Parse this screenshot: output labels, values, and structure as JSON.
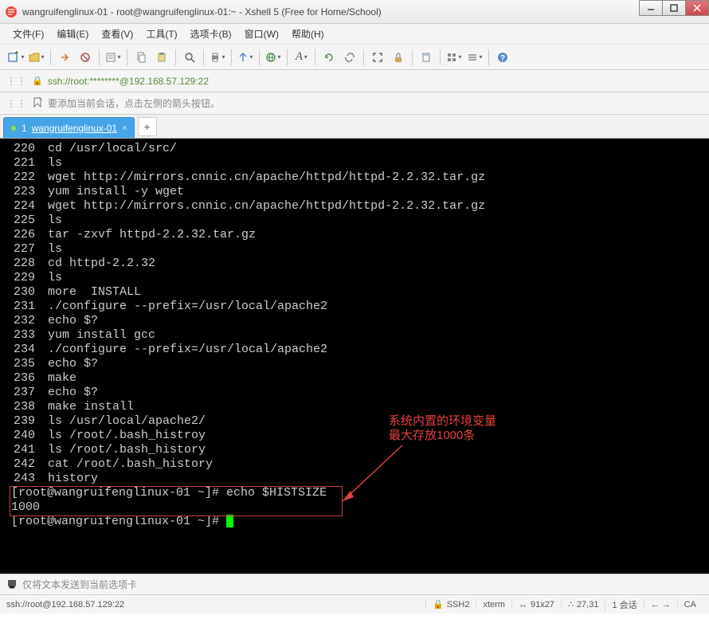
{
  "window": {
    "title": "wangruifenglinux-01 - root@wangruifenglinux-01:~ - Xshell 5 (Free for Home/School)"
  },
  "menu": {
    "file": "文件(F)",
    "edit": "编辑(E)",
    "view": "查看(V)",
    "tools": "工具(T)",
    "tabs": "选项卡(B)",
    "window": "窗口(W)",
    "help": "帮助(H)"
  },
  "address": {
    "url": "ssh://root:********@192.168.57.129:22"
  },
  "infobar": {
    "text": "要添加当前会话，点击左侧的箭头按钮。"
  },
  "tab": {
    "index": "1",
    "label": "wangruifenglinux-01"
  },
  "terminal": {
    "lines": [
      {
        "n": "220",
        "t": "cd /usr/local/src/"
      },
      {
        "n": "221",
        "t": "ls"
      },
      {
        "n": "222",
        "t": "wget http://mirrors.cnnic.cn/apache/httpd/httpd-2.2.32.tar.gz"
      },
      {
        "n": "223",
        "t": "yum install -y wget"
      },
      {
        "n": "224",
        "t": "wget http://mirrors.cnnic.cn/apache/httpd/httpd-2.2.32.tar.gz"
      },
      {
        "n": "225",
        "t": "ls"
      },
      {
        "n": "226",
        "t": "tar -zxvf httpd-2.2.32.tar.gz"
      },
      {
        "n": "227",
        "t": "ls"
      },
      {
        "n": "228",
        "t": "cd httpd-2.2.32"
      },
      {
        "n": "229",
        "t": "ls"
      },
      {
        "n": "230",
        "t": "more  INSTALL"
      },
      {
        "n": "231",
        "t": "./configure --prefix=/usr/local/apache2"
      },
      {
        "n": "232",
        "t": "echo $?"
      },
      {
        "n": "233",
        "t": "yum install gcc"
      },
      {
        "n": "234",
        "t": "./configure --prefix=/usr/local/apache2"
      },
      {
        "n": "235",
        "t": "echo $?"
      },
      {
        "n": "236",
        "t": "make"
      },
      {
        "n": "237",
        "t": "echo $?"
      },
      {
        "n": "238",
        "t": "make install"
      },
      {
        "n": "239",
        "t": "ls /usr/local/apache2/"
      },
      {
        "n": "240",
        "t": "ls /root/.bash_histroy"
      },
      {
        "n": "241",
        "t": "ls /root/.bash_history"
      },
      {
        "n": "242",
        "t": "cat /root/.bash_history"
      },
      {
        "n": "243",
        "t": "history"
      }
    ],
    "prompt1": "[root@wangruifenglinux-01 ~]# echo $HISTSIZE",
    "output1": "1000",
    "prompt2": "[root@wangruifenglinux-01 ~]# "
  },
  "annotation": {
    "line1": "系统内置的环境变量",
    "line2": "最大存放1000条"
  },
  "sendbar": {
    "text": "仅将文本发送到当前选项卡"
  },
  "status": {
    "connection": "ssh://root@192.168.57.129:22",
    "ssh": "SSH2",
    "term": "xterm",
    "size": "91x27",
    "pos": "27,31",
    "sessions": "1 会话",
    "caps": "CA"
  }
}
